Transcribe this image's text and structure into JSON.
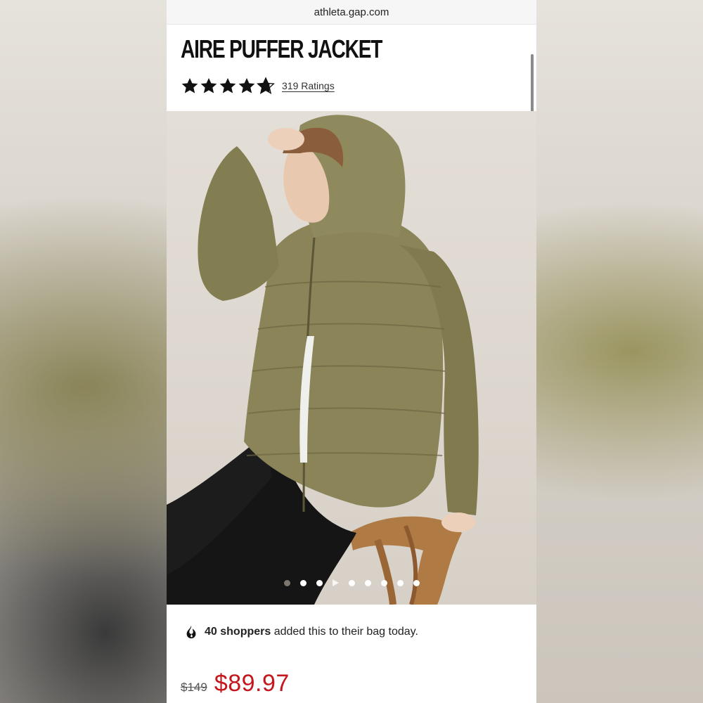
{
  "browser": {
    "url": "athleta.gap.com"
  },
  "product": {
    "title": "AIRE PUFFER JACKET",
    "rating_value": 4.7,
    "ratings_link": "319 Ratings"
  },
  "gallery": {
    "image_alt": "Woman in olive hooded puffer jacket seated on wooden chair",
    "slide_count": 8,
    "active_index": 1,
    "colors": {
      "jacket": "#8a8458",
      "backdrop": "#ddd7cf",
      "pants": "#141414",
      "chair": "#b07a45"
    }
  },
  "social_proof": {
    "icon": "flame-icon",
    "count_text": "40 shoppers",
    "rest_text": " added this to their bag today."
  },
  "pricing": {
    "original": "$149",
    "sale": "$89.97",
    "sale_color": "#c4161c"
  }
}
